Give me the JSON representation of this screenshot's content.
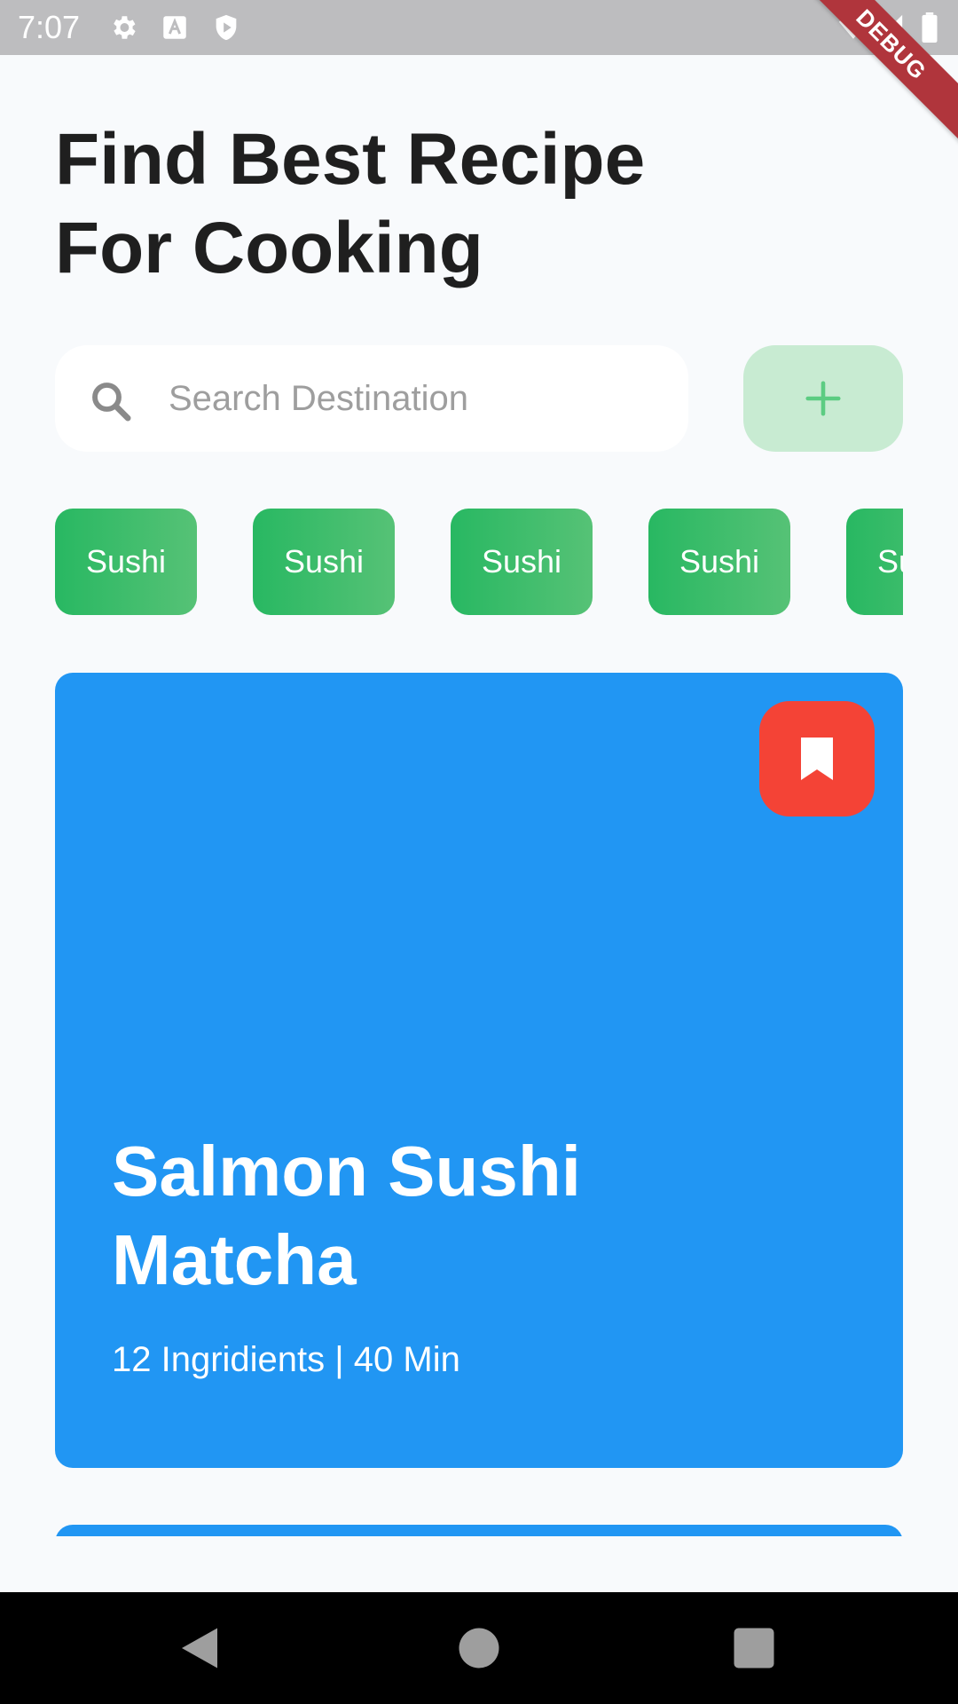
{
  "status_bar": {
    "time": "7:07",
    "icons": [
      "settings-icon",
      "text-a-icon",
      "shield-play-icon",
      "wifi-icon",
      "signal-icon",
      "battery-icon"
    ],
    "debug_label": "DEBUG",
    "color": "#bdbdbf"
  },
  "header": {
    "title_line1": "Find Best Recipe",
    "title_line2": "For Cooking"
  },
  "search": {
    "placeholder": "Search Destination",
    "value": "",
    "icon": "search-icon"
  },
  "add_button": {
    "icon": "plus-icon",
    "color": "#c8ebd2"
  },
  "categories": [
    {
      "label": "Sushi"
    },
    {
      "label": "Sushi"
    },
    {
      "label": "Sushi"
    },
    {
      "label": "Sushi"
    },
    {
      "label": "Sushi"
    }
  ],
  "recipe_card": {
    "title_line1": "Salmon Sushi",
    "title_line2": "Matcha",
    "meta": "12 Ingridients | 40 Min",
    "color": "#2196f3",
    "bookmark_icon": "bookmark-icon",
    "bookmark_color": "#f44336"
  },
  "colors": {
    "accent_green": "#28b862",
    "card_blue": "#2196f3",
    "bookmark_red": "#f44336",
    "background": "#f8fafc"
  },
  "nav_bar": {
    "buttons": [
      "back-icon",
      "home-icon",
      "recents-icon"
    ]
  }
}
